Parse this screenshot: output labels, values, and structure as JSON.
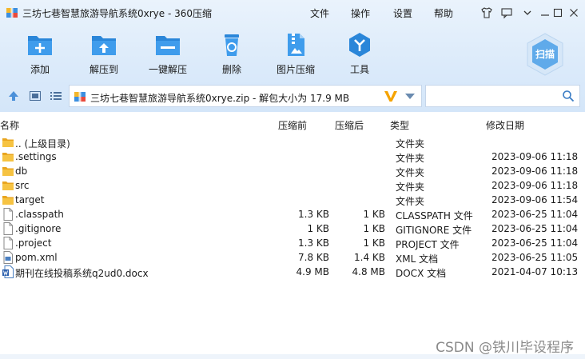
{
  "window": {
    "title": "三坊七巷智慧旅游导航系统0xrye - 360压缩",
    "menus": [
      "文件",
      "操作",
      "设置",
      "帮助"
    ]
  },
  "toolbar": {
    "add": "添加",
    "extract_to": "解压到",
    "one_click": "一键解压",
    "delete": "删除",
    "image_compress": "图片压缩",
    "tools": "工具",
    "scan": "扫描"
  },
  "address": {
    "path": "三坊七巷智慧旅游导航系统0xrye.zip - 解包大小为 17.9 MB",
    "search_placeholder": ""
  },
  "columns": {
    "name": "名称",
    "original": "压缩前",
    "compressed": "压缩后",
    "type": "类型",
    "modified": "修改日期"
  },
  "files": [
    {
      "icon": "folder",
      "name": ".. (上级目录)",
      "orig": "",
      "comp": "",
      "type": "文件夹",
      "date": ""
    },
    {
      "icon": "folder",
      "name": ".settings",
      "orig": "",
      "comp": "",
      "type": "文件夹",
      "date": "2023-09-06 11:18"
    },
    {
      "icon": "folder",
      "name": "db",
      "orig": "",
      "comp": "",
      "type": "文件夹",
      "date": "2023-09-06 11:18"
    },
    {
      "icon": "folder",
      "name": "src",
      "orig": "",
      "comp": "",
      "type": "文件夹",
      "date": "2023-09-06 11:18"
    },
    {
      "icon": "folder",
      "name": "target",
      "orig": "",
      "comp": "",
      "type": "文件夹",
      "date": "2023-09-06 11:54"
    },
    {
      "icon": "file",
      "name": ".classpath",
      "orig": "1.3 KB",
      "comp": "1 KB",
      "type": "CLASSPATH 文件",
      "date": "2023-06-25 11:04"
    },
    {
      "icon": "file",
      "name": ".gitignore",
      "orig": "1 KB",
      "comp": "1 KB",
      "type": "GITIGNORE 文件",
      "date": "2023-06-25 11:04"
    },
    {
      "icon": "file",
      "name": ".project",
      "orig": "1.3 KB",
      "comp": "1 KB",
      "type": "PROJECT 文件",
      "date": "2023-06-25 11:04"
    },
    {
      "icon": "xml",
      "name": "pom.xml",
      "orig": "7.8 KB",
      "comp": "1.4 KB",
      "type": "XML 文档",
      "date": "2023-06-25 11:05"
    },
    {
      "icon": "docx",
      "name": "期刊在线投稿系统q2ud0.docx",
      "orig": "4.9 MB",
      "comp": "4.8 MB",
      "type": "DOCX 文档",
      "date": "2021-04-07 10:13"
    }
  ],
  "watermark": "CSDN @铁川毕设程序",
  "colors": {
    "accent": "#2a86d9",
    "folder": "#f2b631",
    "v_mark": "#f5a300"
  }
}
